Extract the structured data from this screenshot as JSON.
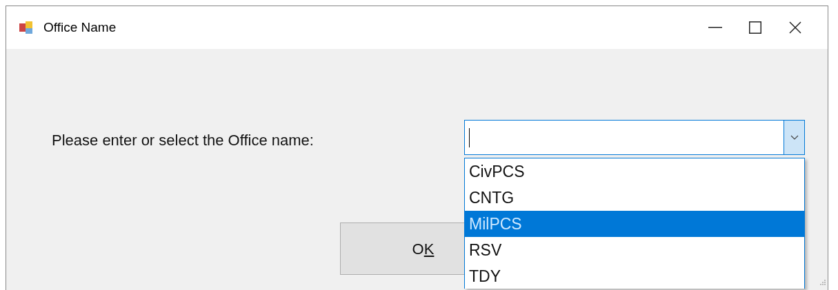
{
  "window": {
    "title": "Office Name"
  },
  "prompt": "Please enter or select the Office name:",
  "combo": {
    "open": true,
    "options": [
      {
        "label": "CivPCS",
        "selected": false
      },
      {
        "label": "CNTG",
        "selected": false
      },
      {
        "label": "MilPCS",
        "selected": true
      },
      {
        "label": "RSV",
        "selected": false
      },
      {
        "label": "TDY",
        "selected": false
      }
    ]
  },
  "ok_button": {
    "label_parts": [
      {
        "text": "O",
        "underlined": false
      },
      {
        "text": "K",
        "underlined": true
      }
    ]
  }
}
